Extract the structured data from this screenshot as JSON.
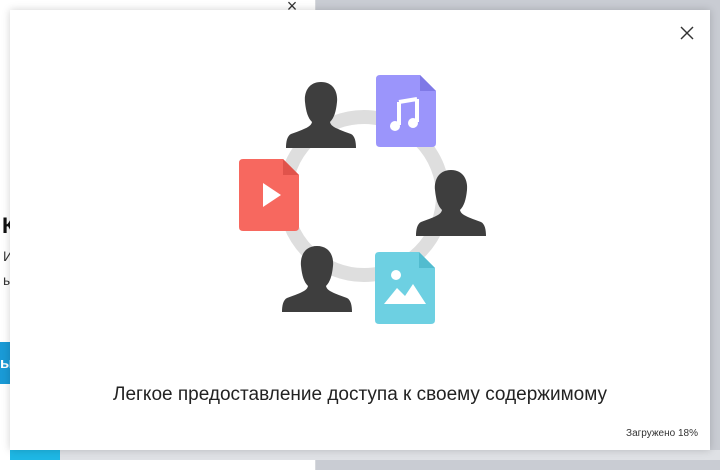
{
  "background_window": {
    "close_glyph": "×",
    "heading_fragment": "К",
    "text_line1_fragment": "И",
    "text_line2_fragment": "ы",
    "button_fragment": "ы",
    "progress_fraction": 0.07,
    "accent_color": "#1eb7e4",
    "button_color": "#1a9ad6"
  },
  "dialog": {
    "close_icon": "close-icon",
    "caption": "Легкое предоставление доступа к своему содержимому",
    "status": "Загружено 18%",
    "illustration": {
      "ring_color": "#dedede",
      "person_color": "#3e3e3e",
      "music_file_color": "#9b95fb",
      "video_file_color": "#f7685f",
      "image_file_color": "#6dd0e2"
    }
  }
}
